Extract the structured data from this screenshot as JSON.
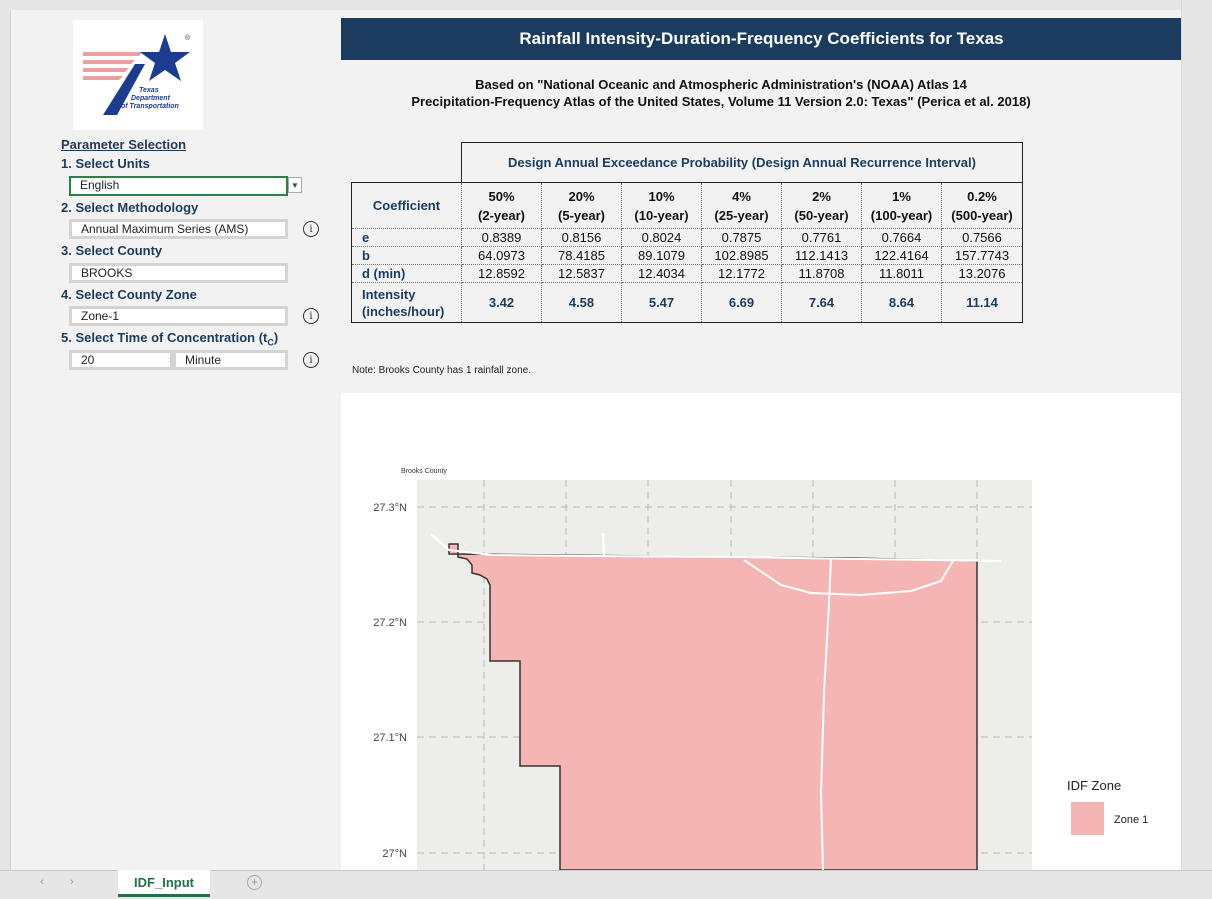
{
  "header": {
    "title": "Rainfall Intensity-Duration-Frequency Coefficients for Texas",
    "subtitle_line1": "Based on \"National Oceanic and Atmospheric Administration's (NOAA) Atlas 14",
    "subtitle_line2": "Precipitation-Frequency Atlas of the United States, Volume 11 Version 2.0: Texas\" (Perica et al. 2018)"
  },
  "logo": {
    "line1": "Texas",
    "line2": "Department",
    "line3": "of Transportation",
    "registered": "®"
  },
  "params": {
    "heading": "Parameter Selection",
    "step1": "1.  Select Units",
    "units": "English",
    "step2": "2.  Select Methodology",
    "methodology": "Annual Maximum Series (AMS)",
    "step3": "3.  Select County",
    "county": "BROOKS",
    "step4": "4.  Select County Zone",
    "zone": "Zone-1",
    "step5": "5.  Select Time of Concentration (t",
    "step5_sub": "C",
    "step5_end": ")",
    "tc_value": "20",
    "tc_unit": "Minute"
  },
  "table": {
    "group_header": "Design Annual Exceedance Probability (Design Annual Recurrence Interval)",
    "coef_header": "Coefficient",
    "columns": [
      {
        "pct": "50%",
        "yr": "(2-year)"
      },
      {
        "pct": "20%",
        "yr": "(5-year)"
      },
      {
        "pct": "10%",
        "yr": "(10-year)"
      },
      {
        "pct": "4%",
        "yr": "(25-year)"
      },
      {
        "pct": "2%",
        "yr": "(50-year)"
      },
      {
        "pct": "1%",
        "yr": "(100-year)"
      },
      {
        "pct": "0.2%",
        "yr": "(500-year)"
      }
    ],
    "rows": [
      {
        "label": "e",
        "values": [
          "0.8389",
          "0.8156",
          "0.8024",
          "0.7875",
          "0.7761",
          "0.7664",
          "0.7566"
        ]
      },
      {
        "label": "b",
        "values": [
          "64.0973",
          "78.4185",
          "89.1079",
          "102.8985",
          "112.1413",
          "122.4164",
          "157.7743"
        ]
      },
      {
        "label": "d (min)",
        "values": [
          "12.8592",
          "12.5837",
          "12.4034",
          "12.1772",
          "11.8708",
          "11.8011",
          "13.2076"
        ]
      }
    ],
    "intensity_label1": "Intensity",
    "intensity_label2": "(inches/hour)",
    "intensity": [
      "3.42",
      "4.58",
      "5.47",
      "6.69",
      "7.64",
      "8.64",
      "11.14"
    ]
  },
  "note": "Note: Brooks County has 1 rainfall zone.",
  "map": {
    "title": "Brooks County",
    "lat_labels": [
      "27.3°N",
      "27.2°N",
      "27.1°N",
      "27°N"
    ],
    "legend_title": "IDF Zone",
    "legend_item": "Zone 1",
    "zone_color": "#f6b5b5"
  },
  "tabs": {
    "active": "IDF_Input",
    "prev": "‹",
    "next": "›",
    "add": "+"
  }
}
